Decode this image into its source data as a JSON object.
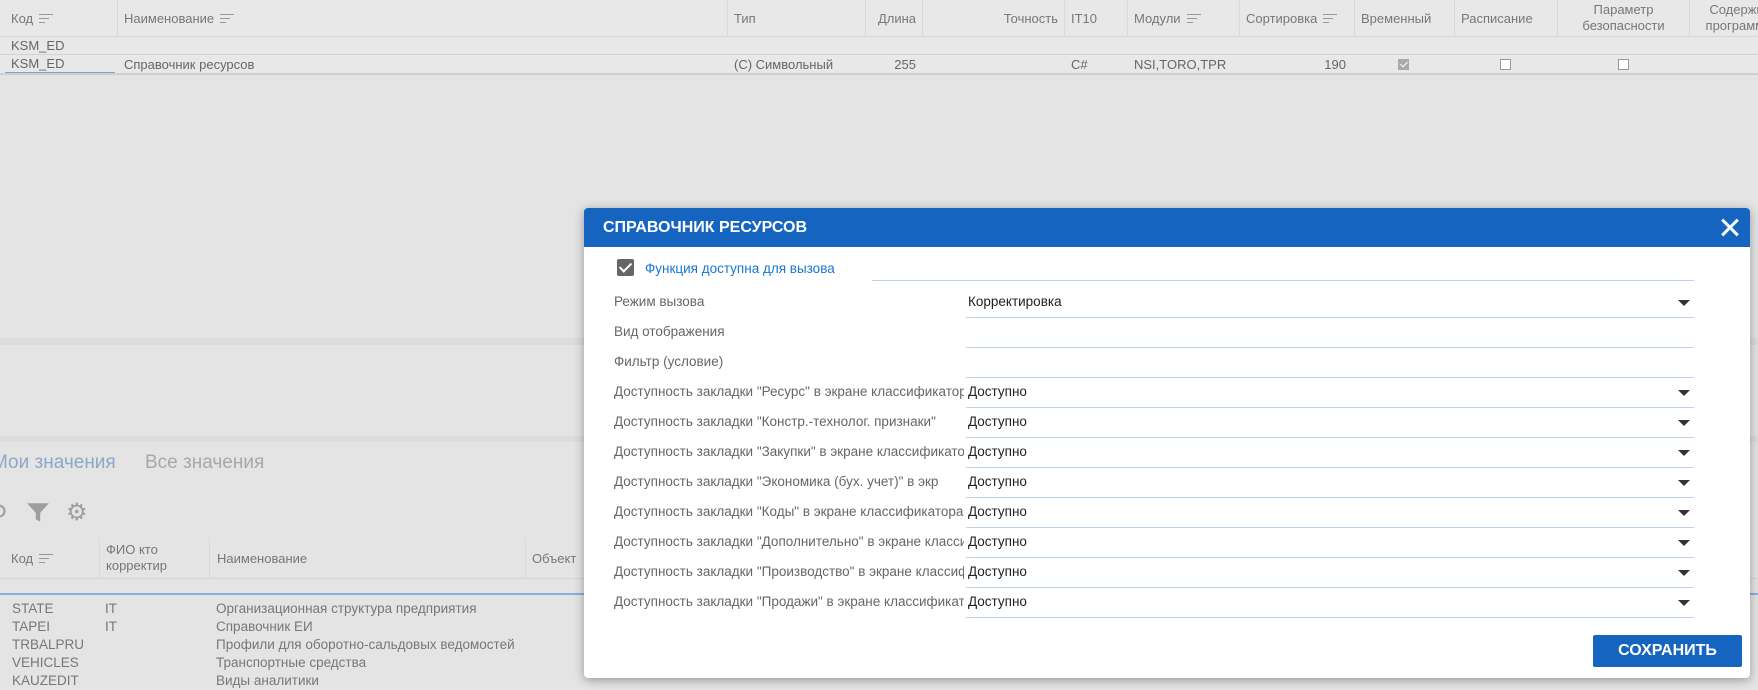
{
  "grid": {
    "headers": [
      {
        "label": "Код",
        "sort": true
      },
      {
        "label": "Наименование",
        "sort": true
      },
      {
        "label": "Тип",
        "sort": false
      },
      {
        "label": "Длина",
        "sort": false
      },
      {
        "label": "Точность",
        "sort": false
      },
      {
        "label": "IT10",
        "sort": false
      },
      {
        "label": "Модули",
        "sort": true
      },
      {
        "label": "Сортировка",
        "sort": true
      },
      {
        "label": "Временный",
        "sort": false
      },
      {
        "label": "Расписание",
        "sort": false
      },
      {
        "label": "Параметр безопасности",
        "sort": false
      },
      {
        "label": "Содержит программы",
        "sort": false
      }
    ],
    "filter_value": "KSM_ED",
    "row": {
      "code": "KSM_ED",
      "name": "Справочник ресурсов",
      "type": "(С) Символьный",
      "length": "255",
      "precision": "",
      "it10": "C#",
      "modules": "NSI,TORO,TPR",
      "sort": "190",
      "temporary": true,
      "schedule": false,
      "security": false,
      "programs": false
    }
  },
  "tabs": {
    "my_values": "Мои значения",
    "all_values": "Все значения"
  },
  "bottom_grid": {
    "headers": {
      "code": "Код",
      "fio": "ФИО кто корректир",
      "name": "Наименование",
      "object": "Объект"
    },
    "rows": [
      {
        "code": "STATE",
        "fio": "IT",
        "name": "Организационная структура предприятия"
      },
      {
        "code": "TAPEI",
        "fio": "IT",
        "name": "Справочник ЕИ"
      },
      {
        "code": "TRBALPRU",
        "fio": "",
        "name": "Профили для оборотно-сальдовых ведомостей"
      },
      {
        "code": "VEHICLES",
        "fio": "",
        "name": "Транспортные средства"
      },
      {
        "code": "KAUZEDIT",
        "fio": "",
        "name": "Виды аналитики"
      }
    ]
  },
  "modal": {
    "title": "СПРАВОЧНИК РЕСУРСОВ",
    "function_available": {
      "label": "Функция доступна для вызова",
      "checked": true
    },
    "fields": [
      {
        "label": "Режим вызова",
        "value": "Корректировка",
        "dropdown": true
      },
      {
        "label": "Вид отображения",
        "value": "",
        "dropdown": false
      },
      {
        "label": "Фильтр (условие)",
        "value": "",
        "dropdown": false
      },
      {
        "label": "Доступность закладки \"Ресурс\" в экране классификатора",
        "value": "Доступно",
        "dropdown": true
      },
      {
        "label": "Доступность закладки \"Констр.-технолог. признаки\"",
        "value": "Доступно",
        "dropdown": true
      },
      {
        "label": "Доступность закладки \"Закупки\" в экране классификатора",
        "value": "Доступно",
        "dropdown": true
      },
      {
        "label": "Доступность закладки \"Экономика (бух. учет)\" в экр",
        "value": "Доступно",
        "dropdown": true
      },
      {
        "label": "Доступность закладки \"Коды\" в экране классификатора",
        "value": "Доступно",
        "dropdown": true
      },
      {
        "label": "Доступность закладки \"Дополнительно\" в экране классификатора",
        "value": "Доступно",
        "dropdown": true
      },
      {
        "label": "Доступность закладки \"Производство\" в экране классификатора",
        "value": "Доступно",
        "dropdown": true
      },
      {
        "label": "Доступность закладки \"Продажи\" в экране классификатора",
        "value": "Доступно",
        "dropdown": true
      }
    ],
    "save_label": "СОХРАНИТЬ"
  },
  "colors": {
    "accent": "#1565c0",
    "link": "#1976d2"
  }
}
